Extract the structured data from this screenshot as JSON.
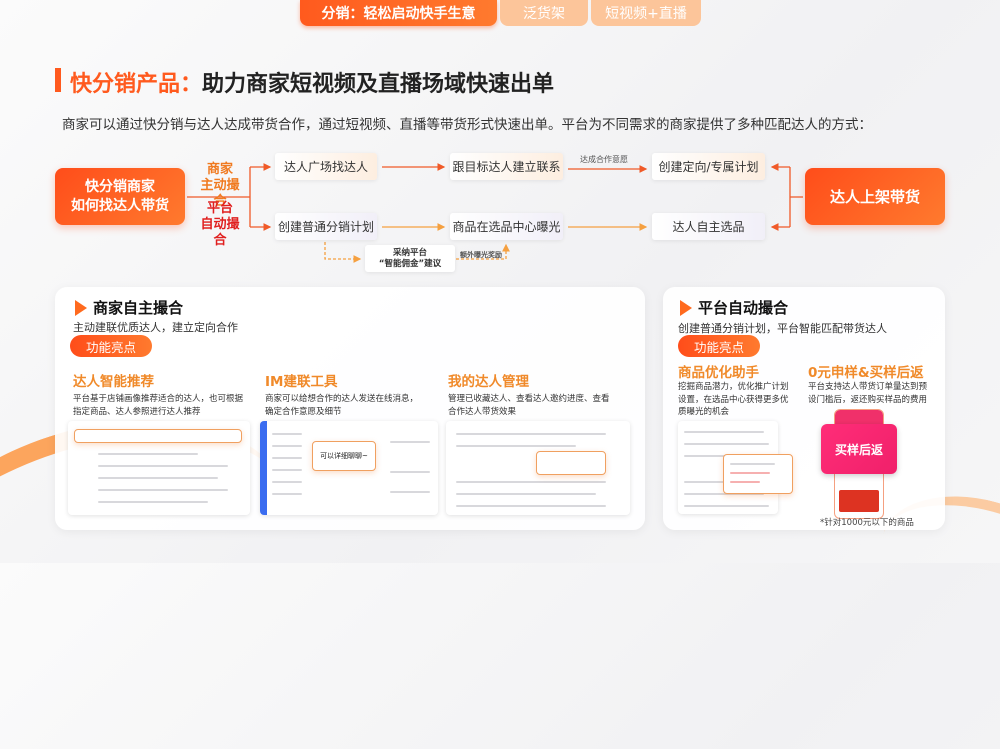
{
  "tabs": [
    {
      "label": "分销：轻松启动快手生意",
      "active": true
    },
    {
      "label": "泛货架",
      "active": false
    },
    {
      "label": "短视频+直播",
      "active": false
    }
  ],
  "title": {
    "highlight": "快分销产品：",
    "rest": "助力商家短视频及直播场域快速出单"
  },
  "subtitle": "商家可以通过快分销与达人达成带货合作，通过短视频、直播等带货形式快速出单。平台为不同需求的商家提供了多种匹配达人的方式：",
  "flow": {
    "start": [
      "快分销商家",
      "如何找达人带货"
    ],
    "branch_merchant": [
      "商家",
      "主动撮合"
    ],
    "branch_platform": [
      "平台",
      "自动撮合"
    ],
    "row1": [
      "达人广场找达人",
      "跟目标达人建立联系",
      "创建定向/专属计划"
    ],
    "row2": [
      "创建普通分销计划",
      "商品在选品中心曝光",
      "达人自主选品"
    ],
    "edge_label_intent": "达成合作意愿",
    "suggestion": [
      "采纳平台",
      "“智能佣金”建议"
    ],
    "edge_label_exposure": "额外曝光奖励",
    "end": "达人上架带货"
  },
  "left_card": {
    "title": "商家自主撮合",
    "subtitle": "主动建联优质达人，建立定向合作",
    "pill": "功能亮点",
    "features": [
      {
        "title": "达人智能推荐",
        "desc": [
          "平台基于店铺画像推荐适合的达人，也可根据",
          "指定商品、达人参照进行达人推荐"
        ]
      },
      {
        "title": "IM建联工具",
        "desc": [
          "商家可以给想合作的达人发送在线消息，",
          "确定合作意愿及细节"
        ],
        "chat_bubble": "可以详细聊聊~"
      },
      {
        "title": "我的达人管理",
        "desc": [
          "管理已收藏达人、查看达人邀约进度、查看",
          "合作达人带货效果"
        ]
      }
    ]
  },
  "right_card": {
    "title": "平台自动撮合",
    "subtitle": "创建普通分销计划，平台智能匹配带货达人",
    "pill": "功能亮点",
    "features": [
      {
        "title": "商品优化助手",
        "desc": [
          "挖掘商品潜力，优化推广计划",
          "设置，在选品中心获得更多优",
          "质曝光的机会"
        ]
      },
      {
        "title": "0元申样&买样后返",
        "desc": [
          "平台支持达人带货订单量达到预",
          "设门槛后，返还购买样品的费用"
        ],
        "banner": "买样后返"
      }
    ],
    "footnote": "*针对1000元以下的商品"
  },
  "colors": {
    "accent": "#ff5a1e",
    "feature_heading": "#f08a2a",
    "branch_merchant": "#f07a20",
    "branch_platform": "#e02020"
  }
}
